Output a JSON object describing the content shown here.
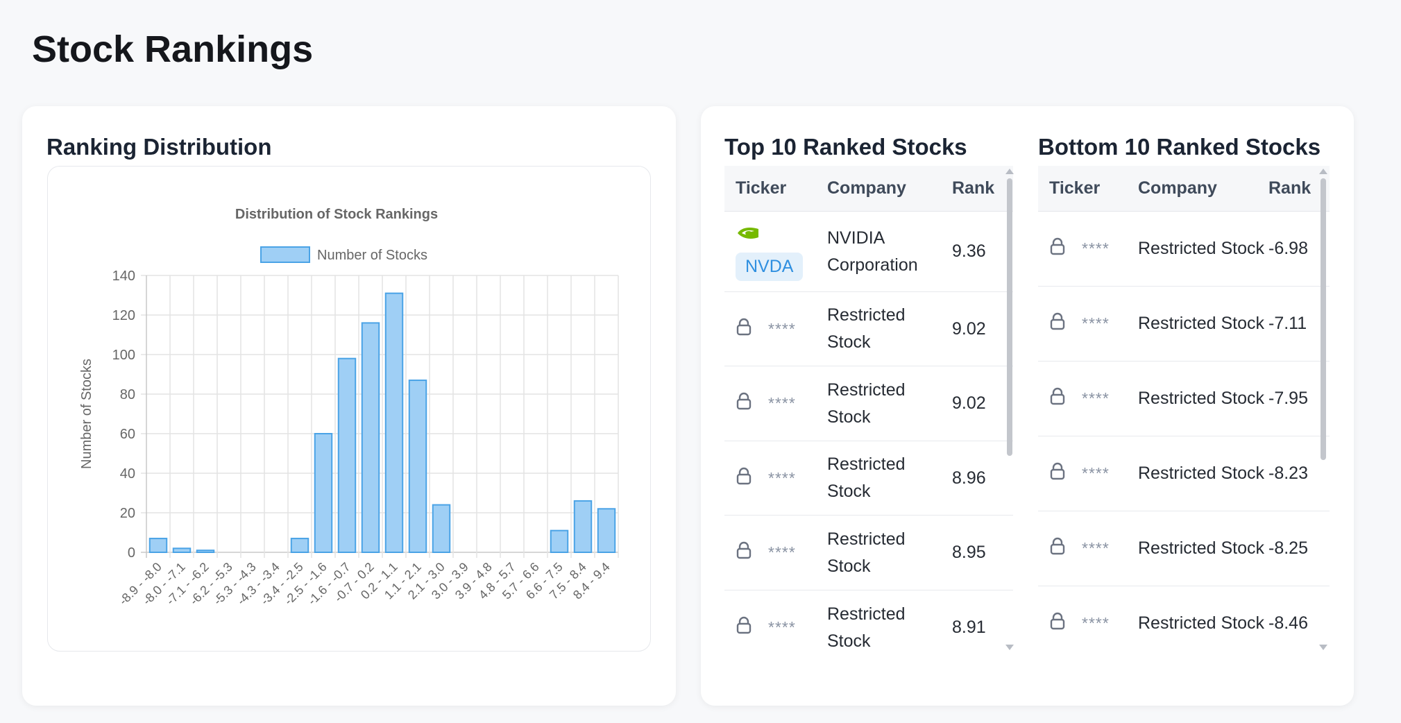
{
  "page": {
    "title": "Stock Rankings"
  },
  "distribution": {
    "section_title": "Ranking Distribution"
  },
  "chart_data": {
    "type": "bar",
    "title": "Distribution of Stock Rankings",
    "legend": [
      "Number of Stocks"
    ],
    "legend_position": "top",
    "ylabel": "Number of Stocks",
    "xlabel": "",
    "ylim": [
      0,
      140
    ],
    "yticks": [
      0,
      20,
      40,
      60,
      80,
      100,
      120,
      140
    ],
    "grid": true,
    "categories": [
      "-8.9 - -8.0",
      "-8.0 - -7.1",
      "-7.1 - -6.2",
      "-6.2 - -5.3",
      "-5.3 - -4.3",
      "-4.3 - -3.4",
      "-3.4 - -2.5",
      "-2.5 - -1.6",
      "-1.6 - -0.7",
      "-0.7 - 0.2",
      "0.2 - 1.1",
      "1.1 - 2.1",
      "2.1 - 3.0",
      "3.0 - 3.9",
      "3.9 - 4.8",
      "4.8 - 5.7",
      "5.7 - 6.6",
      "6.6 - 7.5",
      "7.5 - 8.4",
      "8.4 - 9.4"
    ],
    "series": [
      {
        "name": "Number of Stocks",
        "values": [
          7,
          2,
          1,
          0,
          0,
          0,
          7,
          60,
          98,
          116,
          131,
          87,
          24,
          0,
          0,
          0,
          0,
          11,
          26,
          22
        ]
      }
    ],
    "colors": {
      "fill": "#9fcff5",
      "stroke": "#4aa3e6"
    }
  },
  "top_table": {
    "section_title": "Top 10 Ranked Stocks",
    "headers": {
      "ticker": "Ticker",
      "company": "Company",
      "rank": "Rank"
    },
    "rows": [
      {
        "ticker": "NVDA",
        "company": "NVIDIA Corporation",
        "rank": "9.36",
        "icon": "nvidia-logo-icon"
      },
      {
        "ticker": "****",
        "company": "Restricted Stock",
        "rank": "9.02",
        "icon": "lock-icon"
      },
      {
        "ticker": "****",
        "company": "Restricted Stock",
        "rank": "9.02",
        "icon": "lock-icon"
      },
      {
        "ticker": "****",
        "company": "Restricted Stock",
        "rank": "8.96",
        "icon": "lock-icon"
      },
      {
        "ticker": "****",
        "company": "Restricted Stock",
        "rank": "8.95",
        "icon": "lock-icon"
      },
      {
        "ticker": "****",
        "company": "Restricted Stock",
        "rank": "8.91",
        "icon": "lock-icon"
      }
    ]
  },
  "bottom_table": {
    "section_title": "Bottom 10 Ranked Stocks",
    "headers": {
      "ticker": "Ticker",
      "company": "Company",
      "rank": "Rank"
    },
    "rows": [
      {
        "ticker": "****",
        "company": "Restricted Stock",
        "rank": "-6.98",
        "icon": "lock-icon"
      },
      {
        "ticker": "****",
        "company": "Restricted Stock",
        "rank": "-7.11",
        "icon": "lock-icon"
      },
      {
        "ticker": "****",
        "company": "Restricted Stock",
        "rank": "-7.95",
        "icon": "lock-icon"
      },
      {
        "ticker": "****",
        "company": "Restricted Stock",
        "rank": "-8.23",
        "icon": "lock-icon"
      },
      {
        "ticker": "****",
        "company": "Restricted Stock",
        "rank": "-8.25",
        "icon": "lock-icon"
      },
      {
        "ticker": "****",
        "company": "Restricted Stock",
        "rank": "-8.46",
        "icon": "lock-icon"
      }
    ]
  }
}
